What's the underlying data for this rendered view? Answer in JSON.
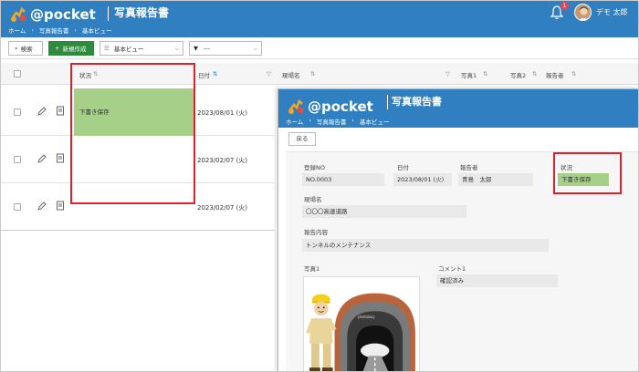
{
  "app": {
    "logo_text": "@pocket",
    "title": "写真報告書"
  },
  "breadcrumb": [
    "ホーム",
    "写真報告書",
    "基本ビュー"
  ],
  "user": {
    "name": "デモ 太郎",
    "notification_count": "1"
  },
  "toolbar": {
    "search_label": "検索",
    "new_label": "新規作成",
    "view_select": "基本ビュー",
    "filter_select": "---"
  },
  "grid": {
    "columns": [
      "状況",
      "日付",
      "現場名",
      "写真1",
      "写真2",
      "報告者"
    ],
    "rows": [
      {
        "status": "下書き保存",
        "date": "2023/08/01 (火)"
      },
      {
        "status": "",
        "date": "2023/02/07 (火)"
      },
      {
        "status": "",
        "date": "2023/02/07 (火)"
      }
    ]
  },
  "detail": {
    "back_label": "戻る",
    "fields": {
      "reg_no": {
        "label": "登録NO",
        "value": "NO.0003"
      },
      "date": {
        "label": "日付",
        "value": "2023/08/01 (火)"
      },
      "reporter": {
        "label": "報告者",
        "value": "青島　太郎"
      },
      "status": {
        "label": "状況",
        "value": "下書き保存"
      },
      "site": {
        "label": "現場名",
        "value": "〇〇〇高速道路"
      },
      "content": {
        "label": "報告内容",
        "value": "トンネルのメンテナンス"
      },
      "photo1": {
        "label": "写真1"
      },
      "comment1": {
        "label": "コメント1",
        "value": "確認済み"
      }
    },
    "photo_watermark": "photoboy"
  },
  "colors": {
    "header_blue": "#2f7fc1",
    "status_green": "#a6cf88",
    "highlight_red": "#e0202a",
    "new_button_green": "#2e8b3e"
  }
}
